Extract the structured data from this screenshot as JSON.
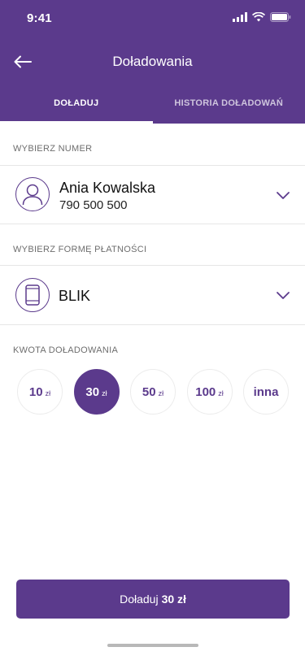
{
  "status_bar": {
    "time": "9:41"
  },
  "header": {
    "title": "Doładowania"
  },
  "tabs": [
    {
      "label": "DOŁADUJ",
      "active": true
    },
    {
      "label": "HISTORIA DOŁADOWAŃ",
      "active": false
    }
  ],
  "number_section": {
    "label": "WYBIERZ NUMER",
    "name": "Ania Kowalska",
    "phone": "790 500 500"
  },
  "payment_section": {
    "label": "WYBIERZ FORMĘ PŁATNOŚCI",
    "method": "BLIK"
  },
  "amount_section": {
    "label": "KWOTA DOŁADOWANIA",
    "options": [
      {
        "value": "10",
        "unit": "zł",
        "selected": false
      },
      {
        "value": "30",
        "unit": "zł",
        "selected": true
      },
      {
        "value": "50",
        "unit": "zł",
        "selected": false
      },
      {
        "value": "100",
        "unit": "zł",
        "selected": false
      },
      {
        "value": "inna",
        "unit": "",
        "selected": false
      }
    ]
  },
  "cta": {
    "prefix": "Doładuj",
    "amount": "30 zł"
  },
  "colors": {
    "brand": "#5b3a8c",
    "background": "#ffffff",
    "divider": "#e6e6e6"
  },
  "icons": [
    "back-arrow-icon",
    "user-icon",
    "phone-device-icon",
    "chevron-down-icon",
    "signal-icon",
    "wifi-icon",
    "battery-icon"
  ]
}
